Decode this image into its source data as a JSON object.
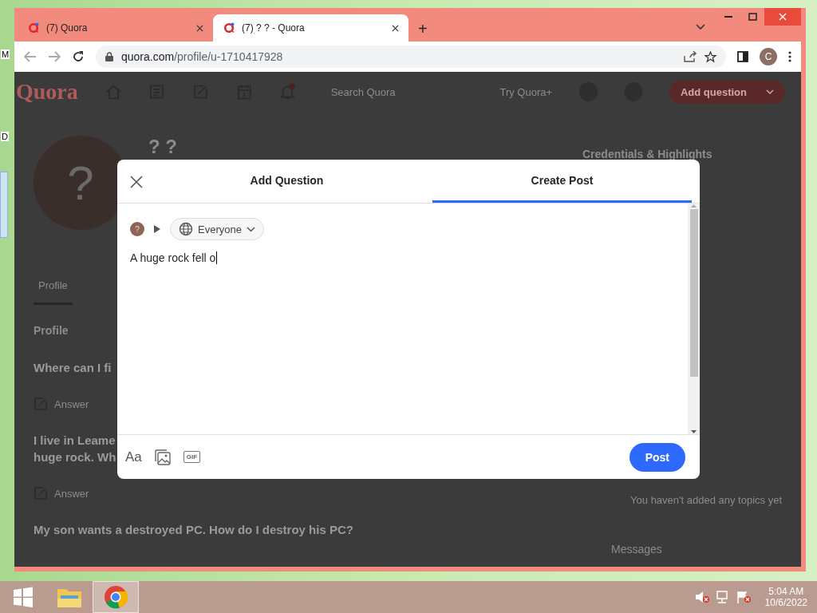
{
  "desktop": {
    "icon_labels": [
      "M",
      "D"
    ]
  },
  "browser": {
    "tabs": [
      {
        "title": "(7) Quora",
        "selected": false
      },
      {
        "title": "(7) ? ? - Quora",
        "selected": true
      }
    ],
    "new_tab": "+",
    "url": {
      "host": "quora.com",
      "path": "/profile/u-1710417928"
    },
    "profile_initial": "C"
  },
  "page": {
    "logo": "Quora",
    "search_placeholder": "Search Quora",
    "try_plus": "Try Quora+",
    "add_question": "Add question",
    "avatar_glyph": "?",
    "profile_name": "? ?",
    "profile_tabs": [
      {
        "label": "Profile",
        "selected": true
      }
    ],
    "section_heading": "Profile",
    "questions": [
      {
        "title_lines": [
          "Where can I fi"
        ],
        "action": "Answer"
      },
      {
        "title_lines": [
          "I live in Leame",
          "huge rock. Wh"
        ],
        "action": "Answer"
      },
      {
        "title_lines": [
          "My son wants a destroyed PC. How do I destroy his PC?"
        ]
      }
    ],
    "sidebar": {
      "heading": "Credentials & Highlights",
      "topics_note": "You haven't added any topics yet",
      "messages": "Messages"
    }
  },
  "modal": {
    "tabs": [
      {
        "label": "Add Question",
        "selected": false
      },
      {
        "label": "Create Post",
        "selected": true
      }
    ],
    "avatar_glyph": "?",
    "audience": "Everyone",
    "value": "A huge rock fell o",
    "format_label": "Aa",
    "gif_label": "GIF",
    "post": "Post"
  },
  "taskbar": {
    "apps": [
      {
        "kind": "explorer",
        "selected": false
      },
      {
        "kind": "chrome",
        "selected": true
      }
    ],
    "time": "5:04 AM",
    "date": "10/6/2022"
  }
}
